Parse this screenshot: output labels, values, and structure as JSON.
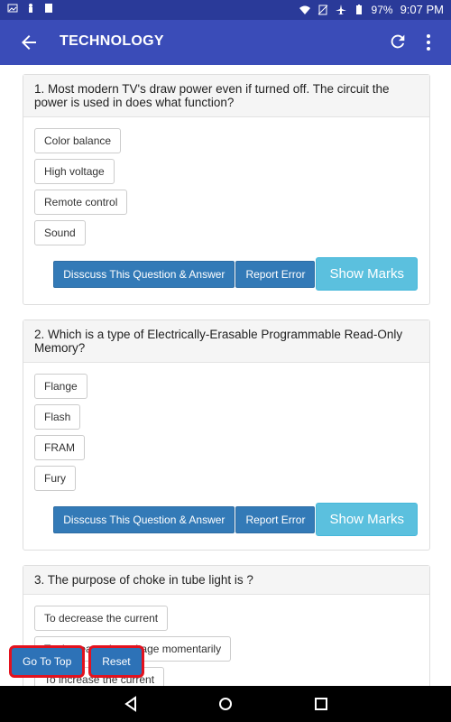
{
  "status_bar": {
    "battery": "97%",
    "time": "9:07 PM"
  },
  "app_bar": {
    "title": "TECHNOLOGY"
  },
  "questions": [
    {
      "text": "1. Most modern TV's draw power even if turned off. The circuit the power is used in does what function?",
      "options": [
        "Color balance",
        "High voltage",
        "Remote control",
        "Sound"
      ]
    },
    {
      "text": "2. Which is a type of Electrically-Erasable Programmable Read-Only Memory?",
      "options": [
        "Flange",
        "Flash",
        "FRAM",
        "Fury"
      ]
    },
    {
      "text": "3. The purpose of choke in tube light is ?",
      "options": [
        "To decrease the current",
        "To decrease the voltage momentarily",
        "To increase the current"
      ]
    }
  ],
  "actions": {
    "discuss": "Disscuss This Question & Answer",
    "report": "Report Error",
    "marks": "Show Marks"
  },
  "floating": {
    "go_top": "Go To Top",
    "reset": "Reset"
  }
}
